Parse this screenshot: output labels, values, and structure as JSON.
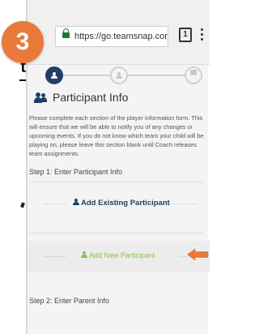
{
  "step_badge": "3",
  "browser": {
    "url": "https://go.teamsnap.com/form",
    "tab_count": "1"
  },
  "form": {
    "title": "Participant Info",
    "description": "Please complete each section of the player information form.  This will ensure that we will be able to notify you of any changes or upcoming events.  If you do not know which team your child will be playing on, please leave this section blank until Coach releases team assignments.",
    "step1_label": "Step 1: Enter Participant Info",
    "add_existing_label": "Add Existing Participant",
    "add_new_label": "Add New Participant",
    "step2_label": "Step 2: Enter Parent Info"
  },
  "colors": {
    "badge": "#e97a3c",
    "brand_navy": "#1f3f66",
    "add_new_green": "#8bc34a",
    "arrow": "#e97a3c"
  },
  "icons": [
    "lock-icon",
    "tabs-icon",
    "menu-icon",
    "participant-icon",
    "team-icon",
    "cart-icon",
    "arrow-icon"
  ]
}
